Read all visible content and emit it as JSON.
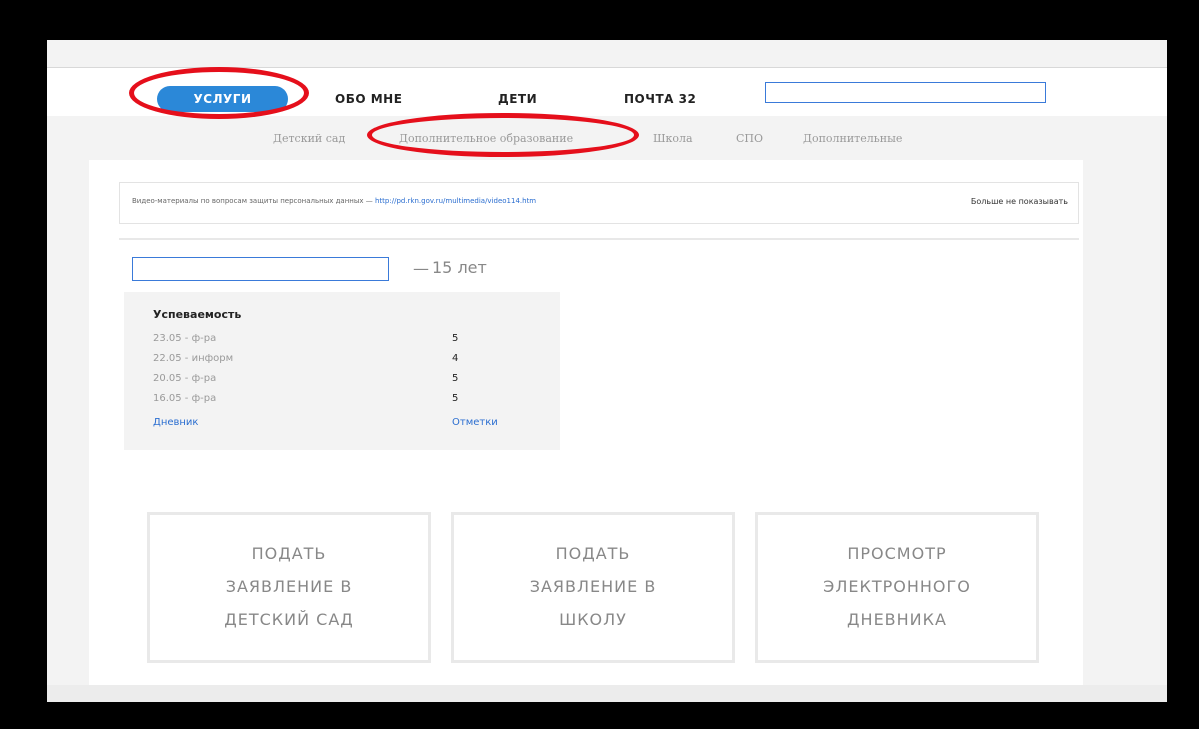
{
  "nav": {
    "items": [
      {
        "label": "УСЛУГИ",
        "active": true
      },
      {
        "label": "ОБО МНЕ",
        "active": false
      },
      {
        "label": "ДЕТИ",
        "active": false
      },
      {
        "label": "ПОЧТА 32",
        "active": false
      }
    ],
    "search_value": ""
  },
  "subnav": {
    "items": [
      "Детский сад",
      "Дополнительное образование",
      "Школа",
      "СПО",
      "Дополнительные"
    ]
  },
  "notice": {
    "text": "Видео-материалы по вопросам защиты персональных данных — ",
    "link": "http://pd.rkn.gov.ru/multimedia/video114.htm",
    "dismiss": "Больше не показывать"
  },
  "child": {
    "name_value": "",
    "dash": "—",
    "age": "15 лет"
  },
  "grades": {
    "title": "Успеваемость",
    "rows": [
      {
        "date": "23.05 - ф-ра",
        "mark": "5"
      },
      {
        "date": "22.05 - информ",
        "mark": "4"
      },
      {
        "date": "20.05 - ф-ра",
        "mark": "5"
      },
      {
        "date": "16.05 - ф-ра",
        "mark": "5"
      }
    ],
    "diary_link": "Дневник",
    "marks_link": "Отметки"
  },
  "tiles": [
    {
      "lines": [
        "ПОДАТЬ",
        "ЗАЯВЛЕНИЕ В",
        "ДЕТСКИЙ САД"
      ]
    },
    {
      "lines": [
        "ПОДАТЬ",
        "ЗАЯВЛЕНИЕ В",
        "ШКОЛУ"
      ]
    },
    {
      "lines": [
        "ПРОСМОТР",
        "ЭЛЕКТРОННОГО",
        "ДНЕВНИКА"
      ]
    }
  ],
  "colors": {
    "accent": "#2b88d8",
    "link": "#2b6ed0",
    "highlight": "#e50f1b"
  }
}
